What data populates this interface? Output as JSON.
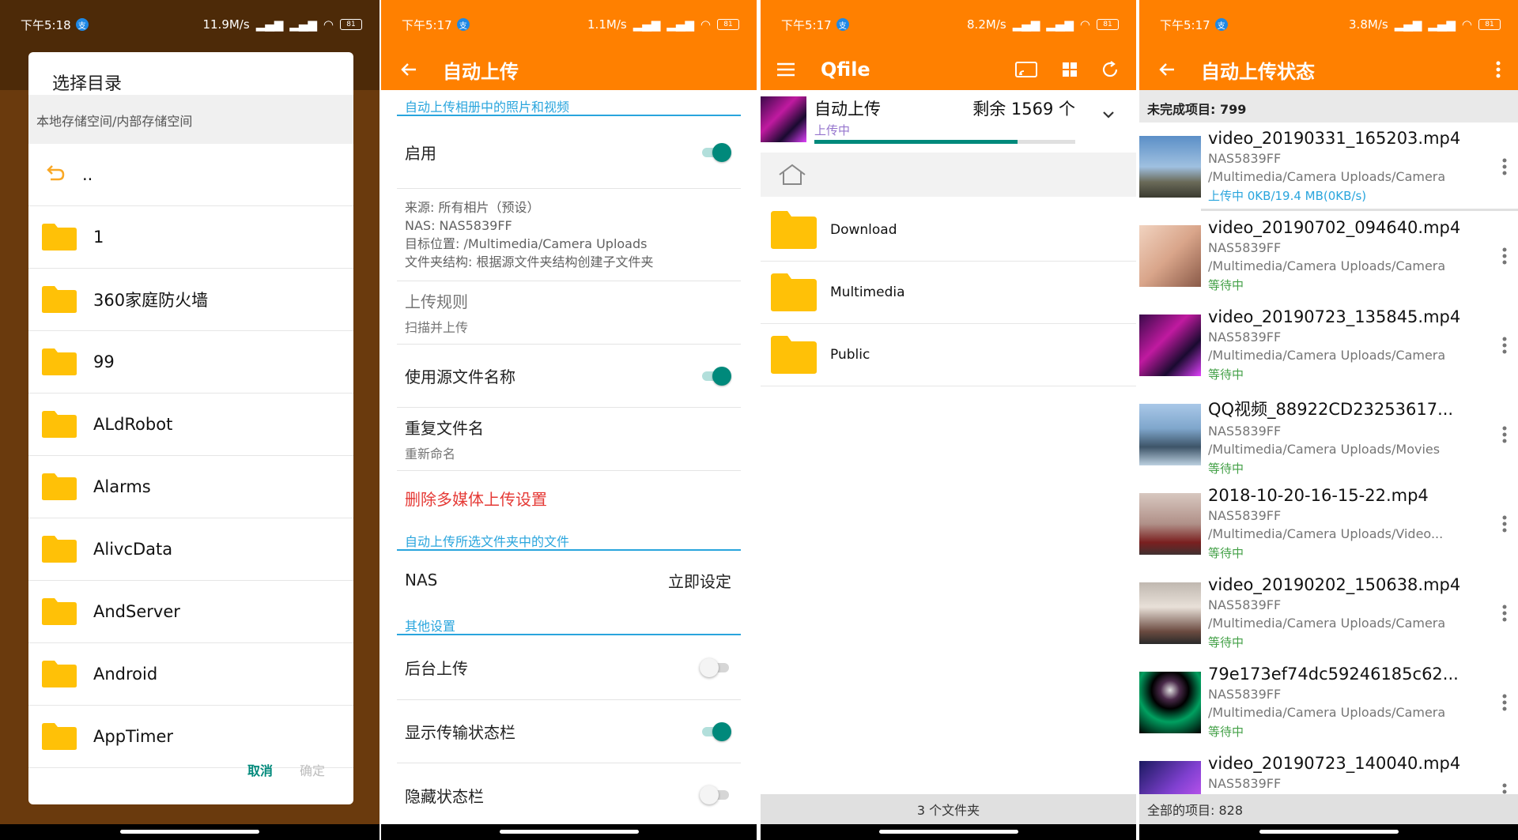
{
  "status": {
    "s1": {
      "time": "下午5:18",
      "speed": "11.9M/s",
      "battery": "81"
    },
    "s2": {
      "time": "下午5:17",
      "speed": "1.1M/s",
      "battery": "81"
    },
    "s3": {
      "time": "下午5:17",
      "speed": "8.2M/s",
      "battery": "81"
    },
    "s4": {
      "time": "下午5:17",
      "speed": "3.8M/s",
      "battery": "81"
    }
  },
  "dialog": {
    "title": "选择目录",
    "path": "本地存储空间/内部存储空间",
    "up_label": "..",
    "folders": [
      "1",
      "360家庭防火墙",
      "99",
      "ALdRobot",
      "Alarms",
      "AlivcData",
      "AndServer",
      "Android",
      "AppTimer"
    ],
    "cancel": "取消",
    "ok": "确定"
  },
  "settings": {
    "title": "自动上传",
    "section1": "自动上传相册中的照片和视频",
    "enable": "启用",
    "info": [
      "来源: 所有相片（预设）",
      "NAS:  NAS5839FF",
      "目标位置: /Multimedia/Camera Uploads",
      "文件夹结构: 根据源文件夹结构创建子文件夹"
    ],
    "rule_title": "上传规则",
    "rule_value": "扫描并上传",
    "use_source_name": "使用源文件名称",
    "dup_title": "重复文件名",
    "dup_value": "重新命名",
    "delete_label": "删除多媒体上传设置",
    "section2": "自动上传所选文件夹中的文件",
    "nas_label": "NAS",
    "nas_action": "立即设定",
    "section3": "其他设置",
    "bg_upload": "后台上传",
    "show_bar": "显示传输状态栏",
    "hide_bar": "隐藏状态栏",
    "toggles": {
      "enable": true,
      "use_source_name": true,
      "bg_upload": false,
      "show_bar": true,
      "hide_bar": false
    }
  },
  "qfile": {
    "title": "Qfile",
    "upload_title": "自动上传",
    "remaining": "剩余 1569 个",
    "upload_status": "上传中",
    "progress": 0.78,
    "folders": [
      "Download",
      "Multimedia",
      "Public"
    ],
    "footer": "3 个文件夹"
  },
  "upload_status": {
    "title": "自动上传状态",
    "incomplete": "未完成项目: 799",
    "total": "全部的项目: 828",
    "items": [
      {
        "name": "video_20190331_165203.mp4",
        "nas": "NAS5839FF",
        "path": "/Multimedia/Camera Uploads/Camera",
        "status": "上传中  0KB/19.4 MB(0KB/s)",
        "state": "uploading"
      },
      {
        "name": "video_20190702_094640.mp4",
        "nas": "NAS5839FF",
        "path": "/Multimedia/Camera Uploads/Camera",
        "status": "等待中",
        "state": "waiting"
      },
      {
        "name": "video_20190723_135845.mp4",
        "nas": "NAS5839FF",
        "path": "/Multimedia/Camera Uploads/Camera",
        "status": "等待中",
        "state": "waiting"
      },
      {
        "name": "QQ视频_88922CD23253617...",
        "nas": "NAS5839FF",
        "path": "/Multimedia/Camera Uploads/Movies",
        "status": "等待中",
        "state": "waiting"
      },
      {
        "name": "2018-10-20-16-15-22.mp4",
        "nas": "NAS5839FF",
        "path": "/Multimedia/Camera Uploads/Video...",
        "status": "等待中",
        "state": "waiting"
      },
      {
        "name": "video_20190202_150638.mp4",
        "nas": "NAS5839FF",
        "path": "/Multimedia/Camera Uploads/Camera",
        "status": "等待中",
        "state": "waiting"
      },
      {
        "name": "79e173ef74dc59246185c62...",
        "nas": "NAS5839FF",
        "path": "/Multimedia/Camera Uploads/Camera",
        "status": "等待中",
        "state": "waiting"
      },
      {
        "name": "video_20190723_140040.mp4",
        "nas": "NAS5839FF",
        "path": "",
        "status": "",
        "state": "waiting"
      }
    ]
  }
}
